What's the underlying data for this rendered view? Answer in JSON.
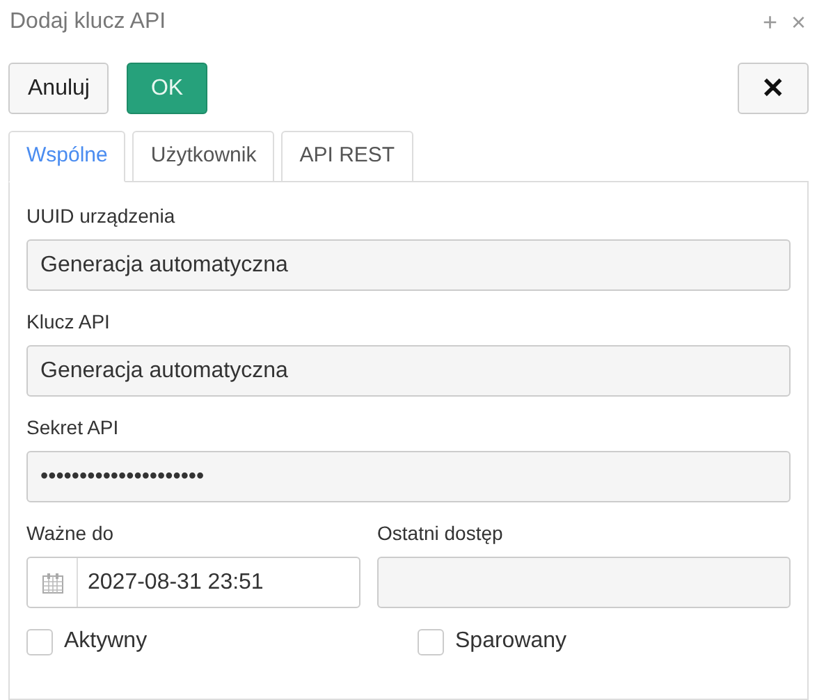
{
  "window": {
    "title": "Dodaj klucz API",
    "buttons": [
      "+",
      "×"
    ]
  },
  "toolbar": {
    "cancel": "Anuluj",
    "ok": "OK",
    "close": "✕"
  },
  "tabs": [
    {
      "label": "Wspólne",
      "selected": true
    },
    {
      "label": "Użytkownik",
      "selected": false
    },
    {
      "label": "API REST",
      "selected": false
    }
  ],
  "fields": [
    {
      "label": "UUID urządzenia",
      "value": "Generacja automatyczna"
    },
    {
      "label": "Klucz API",
      "value": "Generacja automatyczna"
    },
    {
      "label": "Sekret API",
      "value": "•••••••••••••••••••••"
    }
  ],
  "valid_until": {
    "label": "Ważne do",
    "value": "2027-08-31 23:51"
  },
  "last_access": {
    "label": "Ostatni dostęp"
  },
  "checkboxes": [
    {
      "label": "Aktywny",
      "checked": false
    },
    {
      "label": "Sparowany",
      "checked": false
    }
  ]
}
